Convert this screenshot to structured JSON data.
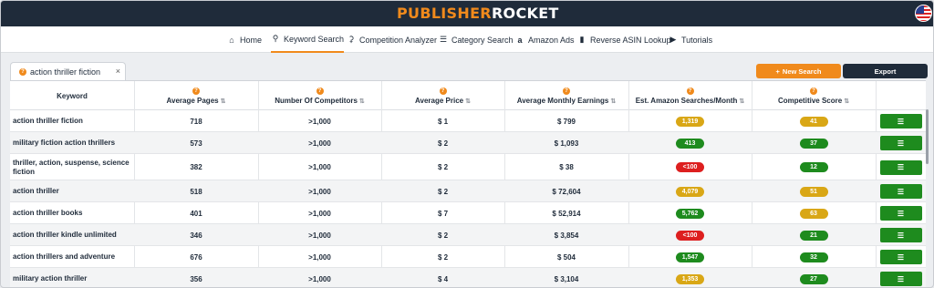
{
  "app": {
    "logo_part1": "PUBLISHER",
    "logo_part2": "ROCKET"
  },
  "colors": {
    "brand_orange": "#f08a1c",
    "navy": "#1f2b3a",
    "pill_yellow": "#d9a716",
    "pill_green": "#1e8b1e",
    "pill_red": "#dd1f1f"
  },
  "nav": [
    {
      "label": "Home",
      "icon": "home-icon"
    },
    {
      "label": "Keyword Search",
      "icon": "search-icon",
      "active": true
    },
    {
      "label": "Competition Analyzer",
      "icon": "award-icon"
    },
    {
      "label": "Category Search",
      "icon": "list-icon"
    },
    {
      "label": "Amazon Ads",
      "icon": "amazon-icon"
    },
    {
      "label": "Reverse ASIN Lookup",
      "icon": "book-icon"
    },
    {
      "label": "Tutorials",
      "icon": "play-icon"
    }
  ],
  "search_tab": {
    "label": "action thriller fiction"
  },
  "buttons": {
    "new_search": "New Search",
    "export": "Export"
  },
  "table": {
    "headers": [
      {
        "label": "Keyword",
        "sortable": false,
        "info": false
      },
      {
        "label": "Average Pages",
        "sortable": true,
        "info": true
      },
      {
        "label": "Number Of Competitors",
        "sortable": true,
        "info": true
      },
      {
        "label": "Average Price",
        "sortable": true,
        "info": true
      },
      {
        "label": "Average Monthly Earnings",
        "sortable": true,
        "info": true
      },
      {
        "label": "Est. Amazon Searches/Month",
        "sortable": true,
        "info": true
      },
      {
        "label": "Competitive Score",
        "sortable": true,
        "info": true
      }
    ],
    "rows": [
      {
        "keyword": "action thriller fiction",
        "pages": "718",
        "competitors": ">1,000",
        "price": "$ 1",
        "earnings": "$ 799",
        "searches": "1,319",
        "searches_color": "yellow",
        "score": "41",
        "score_color": "yellow"
      },
      {
        "keyword": "military fiction action thrillers",
        "pages": "573",
        "competitors": ">1,000",
        "price": "$ 2",
        "earnings": "$ 1,093",
        "searches": "413",
        "searches_color": "green",
        "score": "37",
        "score_color": "green"
      },
      {
        "keyword": "thriller, action, suspense, science fiction",
        "pages": "382",
        "competitors": ">1,000",
        "price": "$ 2",
        "earnings": "$ 38",
        "searches": "<100",
        "searches_color": "red",
        "score": "12",
        "score_color": "green"
      },
      {
        "keyword": "action thriller",
        "pages": "518",
        "competitors": ">1,000",
        "price": "$ 2",
        "earnings": "$ 72,604",
        "searches": "4,079",
        "searches_color": "yellow",
        "score": "51",
        "score_color": "yellow"
      },
      {
        "keyword": "action thriller books",
        "pages": "401",
        "competitors": ">1,000",
        "price": "$ 7",
        "earnings": "$ 52,914",
        "searches": "5,762",
        "searches_color": "green",
        "score": "63",
        "score_color": "yellow"
      },
      {
        "keyword": "action thriller kindle unlimited",
        "pages": "346",
        "competitors": ">1,000",
        "price": "$ 2",
        "earnings": "$ 3,854",
        "searches": "<100",
        "searches_color": "red",
        "score": "21",
        "score_color": "green"
      },
      {
        "keyword": "action thrillers and adventure",
        "pages": "676",
        "competitors": ">1,000",
        "price": "$ 2",
        "earnings": "$ 504",
        "searches": "1,547",
        "searches_color": "green",
        "score": "32",
        "score_color": "green"
      },
      {
        "keyword": "military action thriller",
        "pages": "356",
        "competitors": ">1,000",
        "price": "$ 4",
        "earnings": "$ 3,104",
        "searches": "1,353",
        "searches_color": "yellow",
        "score": "27",
        "score_color": "green"
      }
    ]
  }
}
